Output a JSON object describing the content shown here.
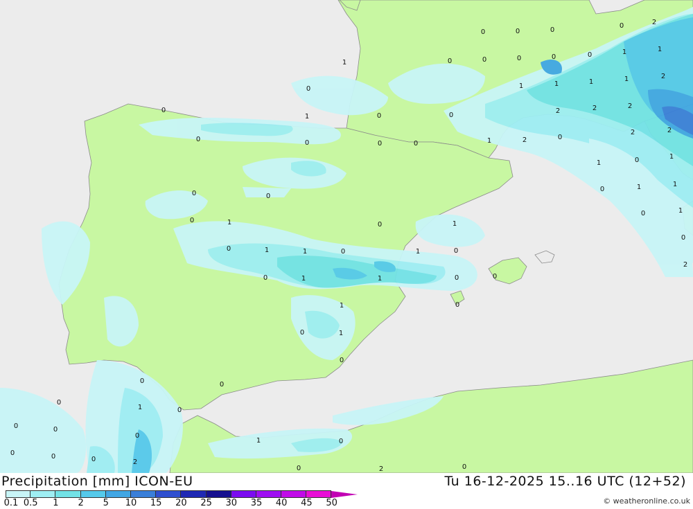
{
  "header": {
    "title": "Precipitation [mm] ICON-EU",
    "datetime": "Tu 16-12-2025 15..16 UTC (12+52)"
  },
  "legend": {
    "items": [
      {
        "label": "0.1",
        "color": "#c8f5f7"
      },
      {
        "label": "0.5",
        "color": "#9eeef3"
      },
      {
        "label": "1",
        "color": "#72e2e6"
      },
      {
        "label": "2",
        "color": "#55c9ea"
      },
      {
        "label": "5",
        "color": "#41a6e4"
      },
      {
        "label": "10",
        "color": "#3a7fd9"
      },
      {
        "label": "15",
        "color": "#2f4fcf"
      },
      {
        "label": "20",
        "color": "#1f29b4"
      },
      {
        "label": "25",
        "color": "#16108f"
      },
      {
        "label": "30",
        "color": "#7b0cf0"
      },
      {
        "label": "35",
        "color": "#9e0ef2"
      },
      {
        "label": "40",
        "color": "#c00ce8"
      },
      {
        "label": "45",
        "color": "#e80ed6"
      },
      {
        "label": "50",
        "color": "#c200b4"
      }
    ]
  },
  "credit": "© weatheronline.co.uk",
  "colors": {
    "sea": "#ececec",
    "land": "#c8f7a2",
    "border": "#888888"
  },
  "map_values": [
    "0",
    "0",
    "0",
    "0",
    "0",
    "0",
    "0",
    "0",
    "0",
    "0",
    "0",
    "0",
    "0",
    "0",
    "0",
    "0",
    "0",
    "0",
    "0",
    "0",
    "0",
    "0",
    "0",
    "0",
    "0",
    "0",
    "0",
    "0",
    "0",
    "0",
    "0",
    "0",
    "0",
    "0",
    "0",
    "0",
    "0",
    "0",
    "0",
    "0",
    "0",
    "0",
    "0",
    "0",
    "0",
    "0",
    "0",
    "0",
    "1",
    "1",
    "1",
    "1",
    "1",
    "1",
    "1",
    "1",
    "1",
    "1",
    "1",
    "1",
    "1",
    "1",
    "1",
    "1",
    "1",
    "1",
    "1",
    "1",
    "1",
    "1",
    "1",
    "1",
    "1",
    "2",
    "2",
    "2",
    "2",
    "2",
    "2",
    "2",
    "2",
    "2",
    "2",
    "2"
  ]
}
